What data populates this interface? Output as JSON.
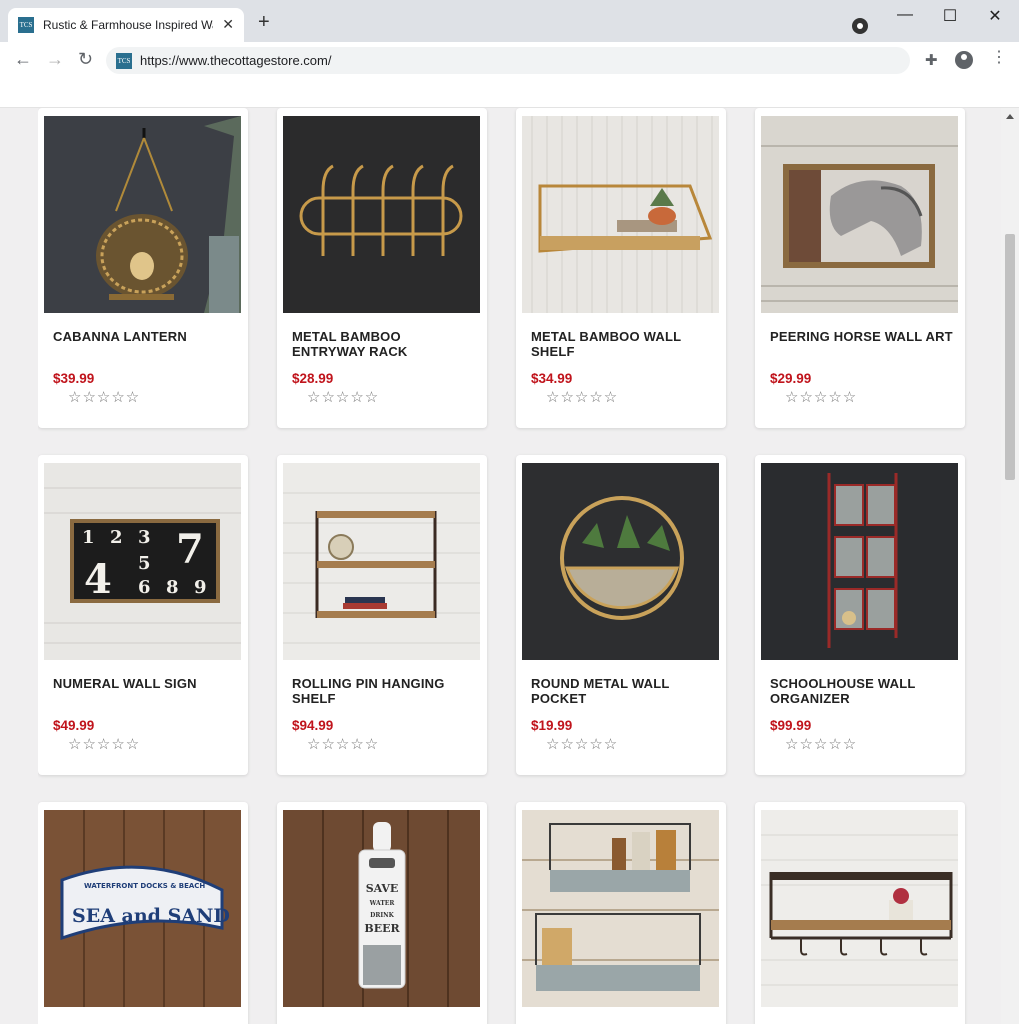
{
  "browser": {
    "tab_title": "Rustic & Farmhouse Inspired Wa",
    "favicon_text": "TCS",
    "url": "https://www.thecottagestore.com/",
    "new_tab": "+",
    "tab_close": "✕",
    "minimize": "—",
    "maximize": "☐",
    "close": "✕",
    "back": "←",
    "forward": "→",
    "reload": "↻",
    "extensions": "✚",
    "menu": "⋮"
  },
  "rating_stars": "☆☆☆☆☆",
  "products": [
    {
      "name": "CABANNA LANTERN",
      "price": "$39.99",
      "icon": "lantern-image"
    },
    {
      "name": "METAL BAMBOO ENTRYWAY RACK",
      "price": "$28.99",
      "icon": "hook-rack-image"
    },
    {
      "name": "METAL BAMBOO WALL SHELF",
      "price": "$34.99",
      "icon": "wall-shelf-image"
    },
    {
      "name": "PEERING HORSE WALL ART",
      "price": "$29.99",
      "icon": "horse-art-image"
    },
    {
      "name": "NUMERAL WALL SIGN",
      "price": "$49.99",
      "icon": "numeral-sign-image"
    },
    {
      "name": "ROLLING PIN HANGING SHELF",
      "price": "$94.99",
      "icon": "hanging-shelf-image"
    },
    {
      "name": "ROUND METAL WALL POCKET",
      "price": "$19.99",
      "icon": "wall-pocket-image"
    },
    {
      "name": "SCHOOLHOUSE WALL ORGANIZER",
      "price": "$99.99",
      "icon": "organizer-image"
    },
    {
      "name": "",
      "price": "",
      "icon": "sea-and-sand-sign-image"
    },
    {
      "name": "",
      "price": "",
      "icon": "bottle-opener-image"
    },
    {
      "name": "",
      "price": "",
      "icon": "metal-shelves-image"
    },
    {
      "name": "",
      "price": "",
      "icon": "wood-shelf-image"
    }
  ],
  "numeral_sign_digits": [
    "1",
    "2",
    "3",
    "7",
    "4",
    "5",
    "6",
    "8",
    "9"
  ],
  "sea_sand_sign": {
    "top_line": "WATERFRONT DOCKS & BEACH",
    "main": "SEA and SAND"
  },
  "bottle_opener_sign": [
    "SAVE",
    "WATER",
    "DRINK",
    "BEER"
  ]
}
